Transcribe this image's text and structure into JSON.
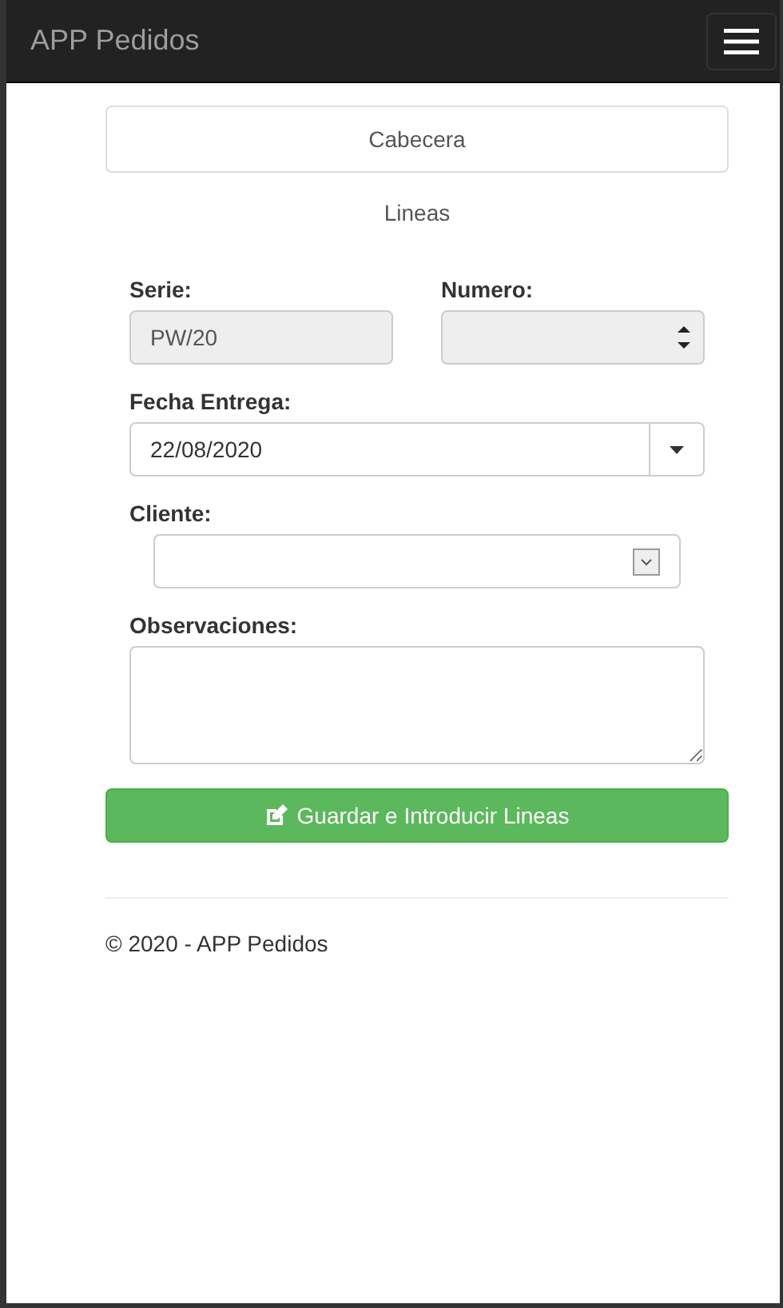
{
  "navbar": {
    "brand": "APP Pedidos"
  },
  "tabs": [
    {
      "label": "Cabecera",
      "selected": true
    },
    {
      "label": "Lineas",
      "selected": false
    }
  ],
  "form": {
    "serie": {
      "label": "Serie:",
      "value": "PW/20",
      "disabled": true
    },
    "numero": {
      "label": "Numero:",
      "disabled": true
    },
    "fecha_entrega": {
      "label": "Fecha Entrega:",
      "value": "22/08/2020"
    },
    "cliente": {
      "label": "Cliente:"
    },
    "observaciones": {
      "label": "Observaciones:"
    }
  },
  "submit_button": {
    "label": "Guardar e Introducir Lineas"
  },
  "footer": {
    "text": "© 2020 - APP Pedidos"
  }
}
